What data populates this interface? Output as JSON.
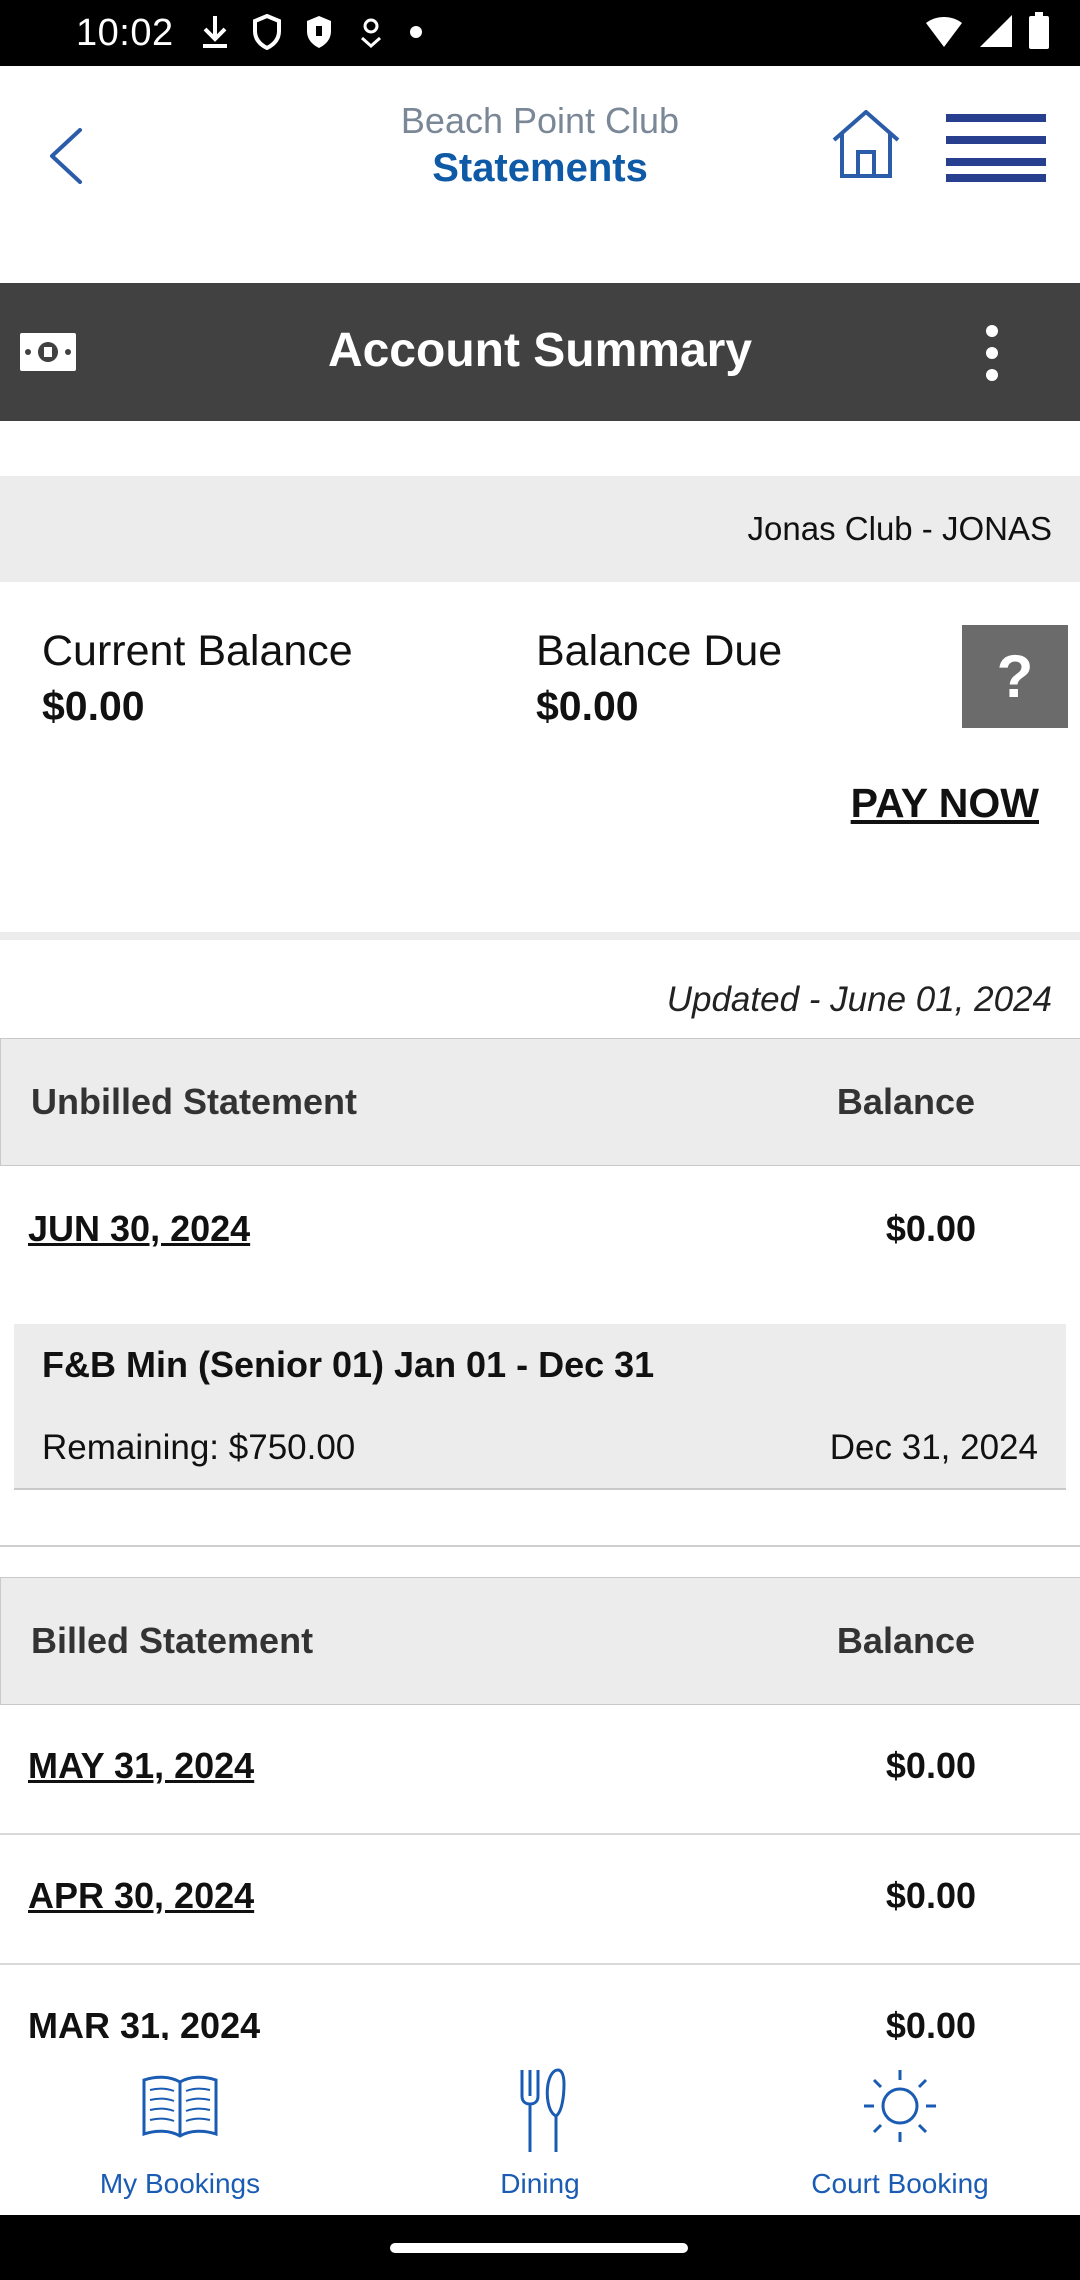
{
  "status_bar": {
    "time": "10:02",
    "icons": [
      "download-icon",
      "shield-icon",
      "shield-filled-icon",
      "location-icon",
      "dot-icon",
      "wifi-icon",
      "signal-icon",
      "battery-icon"
    ]
  },
  "header": {
    "club_name": "Beach Point Club",
    "section_title": "Statements",
    "accent_color": "#0f5aa6"
  },
  "summary_bar": {
    "title": "Account Summary",
    "background": "#414141"
  },
  "account": {
    "club_label": "Jonas Club - JONAS",
    "current_balance_label": "Current Balance",
    "current_balance_value": "$0.00",
    "balance_due_label": "Balance Due",
    "balance_due_value": "$0.00",
    "help_label": "?",
    "pay_now_label": "PAY NOW"
  },
  "updated_text": "Updated - June 01, 2024",
  "unbilled": {
    "header_statement": "Unbilled Statement",
    "header_balance": "Balance",
    "rows": [
      {
        "date": "JUN 30, 2024",
        "balance": "$0.00"
      }
    ],
    "minimum": {
      "title": "F&B Min (Senior 01) Jan 01 - Dec 31",
      "remaining": "Remaining: $750.00",
      "date": "Dec 31, 2024"
    }
  },
  "billed": {
    "header_statement": "Billed Statement",
    "header_balance": "Balance",
    "rows": [
      {
        "date": "MAY 31, 2024",
        "balance": "$0.00"
      },
      {
        "date": "APR 30, 2024",
        "balance": "$0.00"
      },
      {
        "date": "MAR 31, 2024",
        "balance": "$0.00"
      }
    ]
  },
  "bottom_nav": {
    "items": [
      {
        "label": "My Bookings",
        "icon": "open-book-icon"
      },
      {
        "label": "Dining",
        "icon": "fork-knife-icon"
      },
      {
        "label": "Court Booking",
        "icon": "sun-icon"
      }
    ],
    "color": "#1a5bb3"
  }
}
